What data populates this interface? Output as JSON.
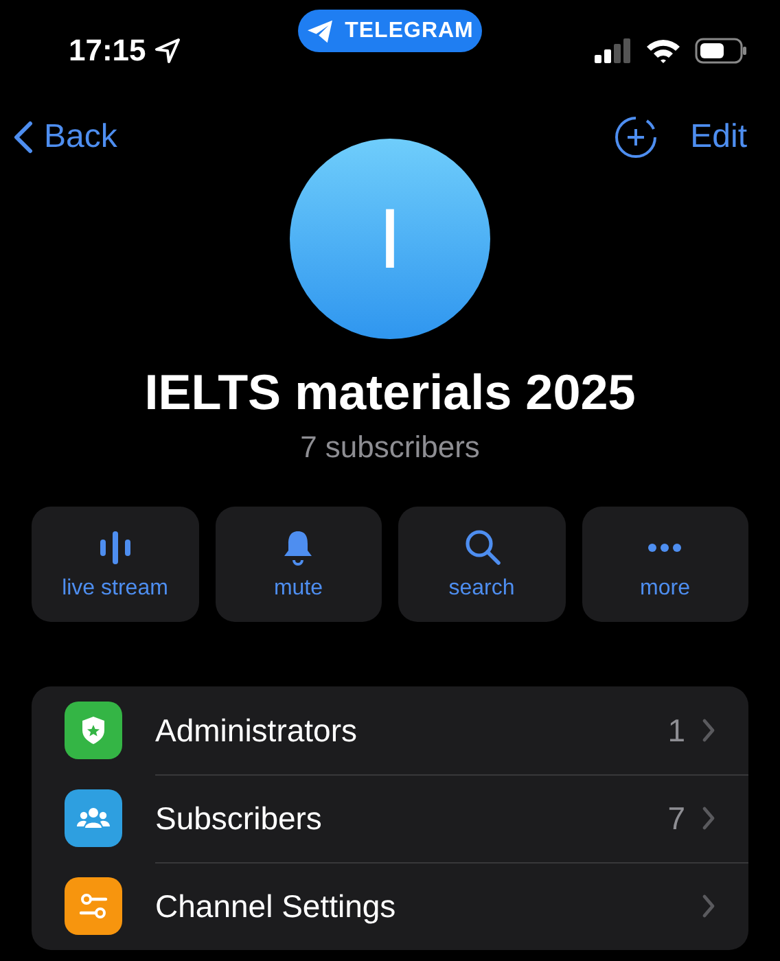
{
  "status_bar": {
    "time": "17:15",
    "app_pill": "TELEGRAM"
  },
  "nav": {
    "back": "Back",
    "edit": "Edit"
  },
  "profile": {
    "avatar_letter": "I",
    "title": "IELTS materials 2025",
    "subtitle": "7 subscribers"
  },
  "actions": [
    {
      "kind": "stream",
      "label": "live stream"
    },
    {
      "kind": "bell",
      "label": "mute"
    },
    {
      "kind": "search",
      "label": "search"
    },
    {
      "kind": "dots",
      "label": "more"
    }
  ],
  "rows": [
    {
      "kind": "shield",
      "color": "#34b545",
      "label": "Administrators",
      "count": "1"
    },
    {
      "kind": "people",
      "color": "#2e9fe0",
      "label": "Subscribers",
      "count": "7"
    },
    {
      "kind": "sliders",
      "color": "#f7950e",
      "label": "Channel Settings"
    }
  ]
}
